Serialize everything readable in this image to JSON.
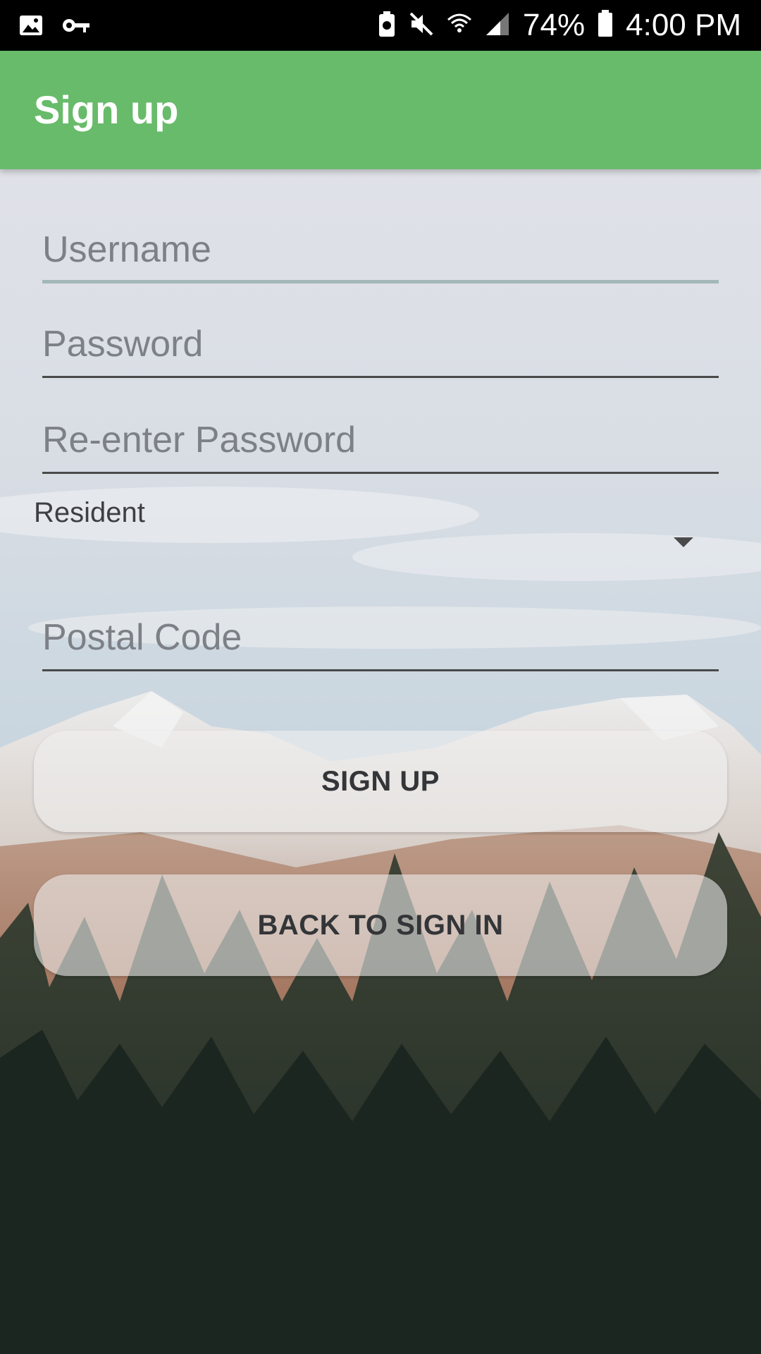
{
  "status_bar": {
    "icons_left": [
      "image-icon",
      "key-icon"
    ],
    "icons_right": [
      "battery-saver-icon",
      "mute-icon",
      "wifi-icon",
      "signal-icon",
      "battery-icon"
    ],
    "battery_percent": "74%",
    "time": "4:00 PM"
  },
  "app_bar": {
    "title": "Sign up",
    "color": "#68bb6a"
  },
  "form": {
    "username": {
      "placeholder": "Username",
      "value": ""
    },
    "password": {
      "placeholder": "Password",
      "value": ""
    },
    "reenter_password": {
      "placeholder": "Re-enter Password",
      "value": ""
    },
    "resident": {
      "label": "Resident",
      "selected": ""
    },
    "postal_code": {
      "placeholder": "Postal Code",
      "value": ""
    }
  },
  "buttons": {
    "sign_up": "SIGN UP",
    "back_to_sign_in": "BACK TO SIGN IN"
  }
}
